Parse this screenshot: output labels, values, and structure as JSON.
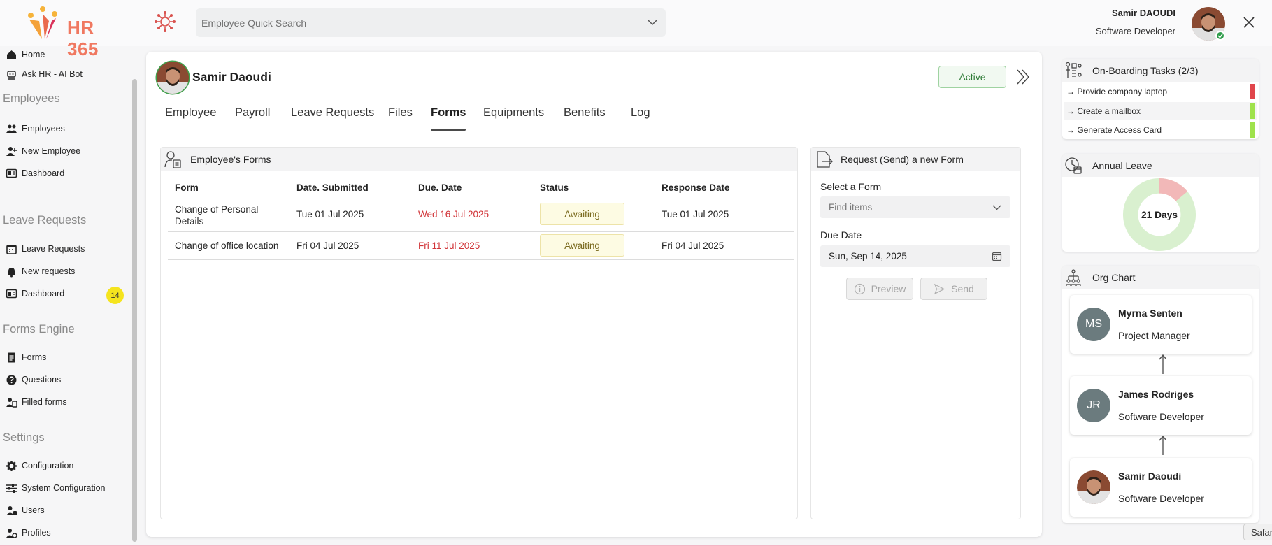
{
  "app": {
    "brand": "HR 365"
  },
  "search": {
    "placeholder": "Employee Quick Search"
  },
  "user": {
    "name": "Samir DAOUDI",
    "role": "Software Developer"
  },
  "sidebar": {
    "top_items": [
      {
        "label": "Home",
        "icon": "home-icon"
      },
      {
        "label": "Ask HR - AI Bot",
        "icon": "bot-icon"
      }
    ],
    "sections": [
      {
        "title": "Employees",
        "items": [
          {
            "label": "Employees",
            "icon": "people-icon"
          },
          {
            "label": "New Employee",
            "icon": "person-add-icon"
          },
          {
            "label": "Dashboard",
            "icon": "dashboard-icon"
          }
        ]
      },
      {
        "title": "Leave Requests",
        "items": [
          {
            "label": "Leave Requests",
            "icon": "calendar-icon",
            "badge": "14"
          },
          {
            "label": "New requests",
            "icon": "bell-icon"
          },
          {
            "label": "Dashboard",
            "icon": "dashboard-icon"
          }
        ]
      },
      {
        "title": "Forms Engine",
        "items": [
          {
            "label": "Forms",
            "icon": "form-icon"
          },
          {
            "label": "Questions",
            "icon": "question-icon"
          },
          {
            "label": "Filled forms",
            "icon": "filled-form-icon"
          }
        ]
      },
      {
        "title": "Settings",
        "items": [
          {
            "label": "Configuration",
            "icon": "gear-icon"
          },
          {
            "label": "System Configuration",
            "icon": "sliders-icon"
          },
          {
            "label": "Users",
            "icon": "users-icon"
          },
          {
            "label": "Profiles",
            "icon": "profiles-icon"
          }
        ]
      }
    ]
  },
  "employee": {
    "name": "Samir Daoudi",
    "status": "Active"
  },
  "tabs": [
    "Employee",
    "Payroll",
    "Leave Requests",
    "Files",
    "Forms",
    "Equipments",
    "Benefits",
    "Log"
  ],
  "active_tab": "Forms",
  "forms_panel": {
    "title": "Employee's Forms",
    "columns": [
      "Form",
      "Date. Submitted",
      "Due. Date",
      "Status",
      "Response Date"
    ],
    "rows": [
      {
        "form_line1": "Change of Personal",
        "form_line2": "Details",
        "submitted": "Tue 01 Jul 2025",
        "due": "Wed 16 Jul 2025",
        "status": "Awaiting",
        "response": "Tue 01 Jul 2025"
      },
      {
        "form_line1": "Change of office location",
        "form_line2": "",
        "submitted": "Fri 04 Jul 2025",
        "due": "Fri 11 Jul 2025",
        "status": "Awaiting",
        "response": "Fri 04 Jul 2025"
      }
    ]
  },
  "request_panel": {
    "title": "Request (Send) a new Form",
    "select_label": "Select a Form",
    "select_placeholder": "Find items",
    "due_label": "Due Date",
    "due_value": "Sun, Sep 14, 2025",
    "preview_label": "Preview",
    "send_label": "Send"
  },
  "onboarding": {
    "title": "On-Boarding Tasks (2/3)",
    "tasks": [
      {
        "label": "→ Provide company laptop",
        "state_color": "#e0454b"
      },
      {
        "label": "→ Create a mailbox",
        "state_color": "#9fe24c"
      },
      {
        "label": "→ Generate Access Card",
        "state_color": "#9fe24c"
      }
    ]
  },
  "annual_leave": {
    "title": "Annual Leave",
    "center_label": "21 Days",
    "used_fraction": 0.14,
    "colors": {
      "used": "#f2b8b8",
      "remaining": "#d9f0cf"
    }
  },
  "org_chart": {
    "title": "Org Chart",
    "people": [
      {
        "initials": "MS",
        "name": "Myrna Senten",
        "role": "Project Manager"
      },
      {
        "initials": "JR",
        "name": "James Rodriges",
        "role": "Software Developer"
      },
      {
        "initials": "",
        "name": "Samir Daoudi",
        "role": "Software Developer"
      }
    ]
  },
  "system": {
    "safari_label": "Safari"
  },
  "colors": {
    "accent": "#f07860",
    "due_red": "#d13438",
    "active_green": "#2d7a35",
    "badge_yellow": "#f5e41e"
  }
}
